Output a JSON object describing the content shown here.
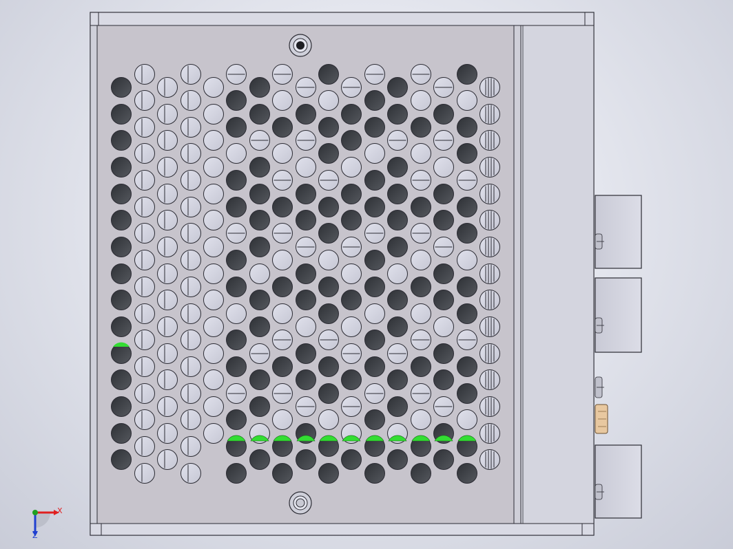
{
  "viewport": {
    "name": "cad-3d-viewport",
    "model": "perforated-enclosure-top-view"
  },
  "colors": {
    "background_center": "#f4f5f9",
    "background_edge": "#c9ccd8",
    "panel_face": "#c7c4cc",
    "frame": "#d9d9e2",
    "side_rail": "#d4d5df",
    "edge_line": "#2b2b33",
    "hole_open": "#d4d5e2",
    "hole_dark": "#3d4045",
    "highlight": "#33dd33",
    "connector": "#d3d4de",
    "fuse": "#e8c8a0",
    "axis_x": "#e02020",
    "axis_y": "#20a020",
    "axis_z": "#2040d0"
  },
  "triad": {
    "x_label": "X",
    "z_label": "Z"
  },
  "icons": [
    "top-screw-icon",
    "bottom-screw-icon",
    "coordinate-triad-icon"
  ]
}
